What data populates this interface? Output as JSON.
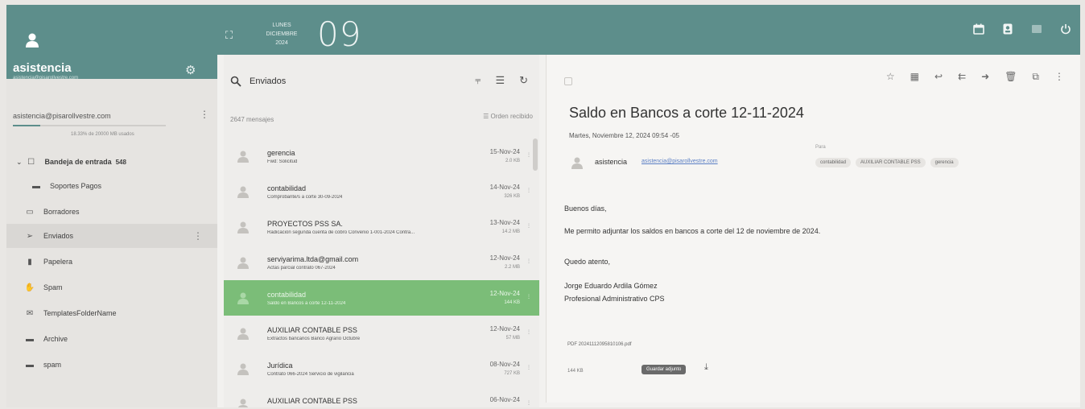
{
  "colors": {
    "accent": "#5d8e8b",
    "selected_row": "#7bbd78"
  },
  "topbar": {
    "weekday": "LUNES",
    "month": "DICIEMBRE",
    "year": "2024",
    "day": "09",
    "icons": [
      "calendar-icon",
      "contacts-icon",
      "notes-icon",
      "power-icon"
    ]
  },
  "account": {
    "name": "asistencia",
    "email_small": "asistencia@pisarollvestre.com",
    "email": "asistencia@pisarollvestre.com",
    "quota_text": "18.33% de 20000 MB usados",
    "quota_fraction": 0.18
  },
  "folders": [
    {
      "label": "Bandeja de entrada",
      "count": "548",
      "icon": "inbox-icon"
    },
    {
      "label": "Soportes Pagos",
      "count": "",
      "icon": "folder-icon"
    },
    {
      "label": "Borradores",
      "count": "",
      "icon": "drafts-icon"
    },
    {
      "label": "Enviados",
      "count": "",
      "icon": "send-icon"
    },
    {
      "label": "Papelera",
      "count": "",
      "icon": "trash-icon"
    },
    {
      "label": "Spam",
      "count": "",
      "icon": "thumbs-down-icon"
    },
    {
      "label": "TemplatesFolderName",
      "count": "",
      "icon": "template-icon"
    },
    {
      "label": "Archive",
      "count": "",
      "icon": "folder-icon"
    },
    {
      "label": "spam",
      "count": "",
      "icon": "folder-icon"
    }
  ],
  "list": {
    "search_text": "Enviados",
    "count": "2647 mensajes",
    "sort_label": "Orden recibido",
    "messages": [
      {
        "from": "gerencia",
        "subject": "Fwd: Solicitud",
        "date": "15-Nov-24",
        "size": "2.0 KB"
      },
      {
        "from": "contabilidad",
        "subject": "Comprobante/s a corte 30-09-2024",
        "date": "14-Nov-24",
        "size": "326 KB"
      },
      {
        "from": "PROYECTOS PSS SA.",
        "subject": "Radicación segunda cuenta de cobro Convenio 1-001-2024 Contra...",
        "date": "13-Nov-24",
        "size": "14.2 MB"
      },
      {
        "from": "serviyarima.ltda@gmail.com",
        "subject": "Actas parcial contrato 067-2024",
        "date": "12-Nov-24",
        "size": "2.2 MB"
      },
      {
        "from": "contabilidad",
        "subject": "Saldo en Bancos a corte 12-11-2024",
        "date": "12-Nov-24",
        "size": "144 KB"
      },
      {
        "from": "AUXILIAR CONTABLE PSS",
        "subject": "Extractos bancarios Banco Agrario Octubre",
        "date": "12-Nov-24",
        "size": "57 MB"
      },
      {
        "from": "Jurídica",
        "subject": "Contrato 066-2024 Servicio de vigilancia",
        "date": "08-Nov-24",
        "size": "727 KB"
      },
      {
        "from": "AUXILIAR CONTABLE PSS",
        "subject": "",
        "date": "06-Nov-24",
        "size": ""
      }
    ]
  },
  "pane": {
    "subject": "Saldo en Bancos a corte 12-11-2024",
    "when": "Martes, Noviembre 12, 2024 09:54 -05",
    "sender_name": "asistencia",
    "sender_addr": "asistencia@pisarollvestre.com",
    "to_label": "Para",
    "recipients": [
      "contabilidad",
      "AUXILIAR CONTABLE PSS",
      "gerencia"
    ],
    "greeting": "Buenos días,",
    "body": "Me permito adjuntar los saldos en bancos a corte del 12 de noviembre de 2024.",
    "closing": "Quedo atento,",
    "sig_name": "Jorge Eduardo Ardila Gómez",
    "sig_title": "Profesional Administrativo CPS",
    "attachment_name": "PDF  20241112095810106.pdf",
    "attachment_size": "144 KB",
    "attachment_button": "Guardar adjunto"
  }
}
